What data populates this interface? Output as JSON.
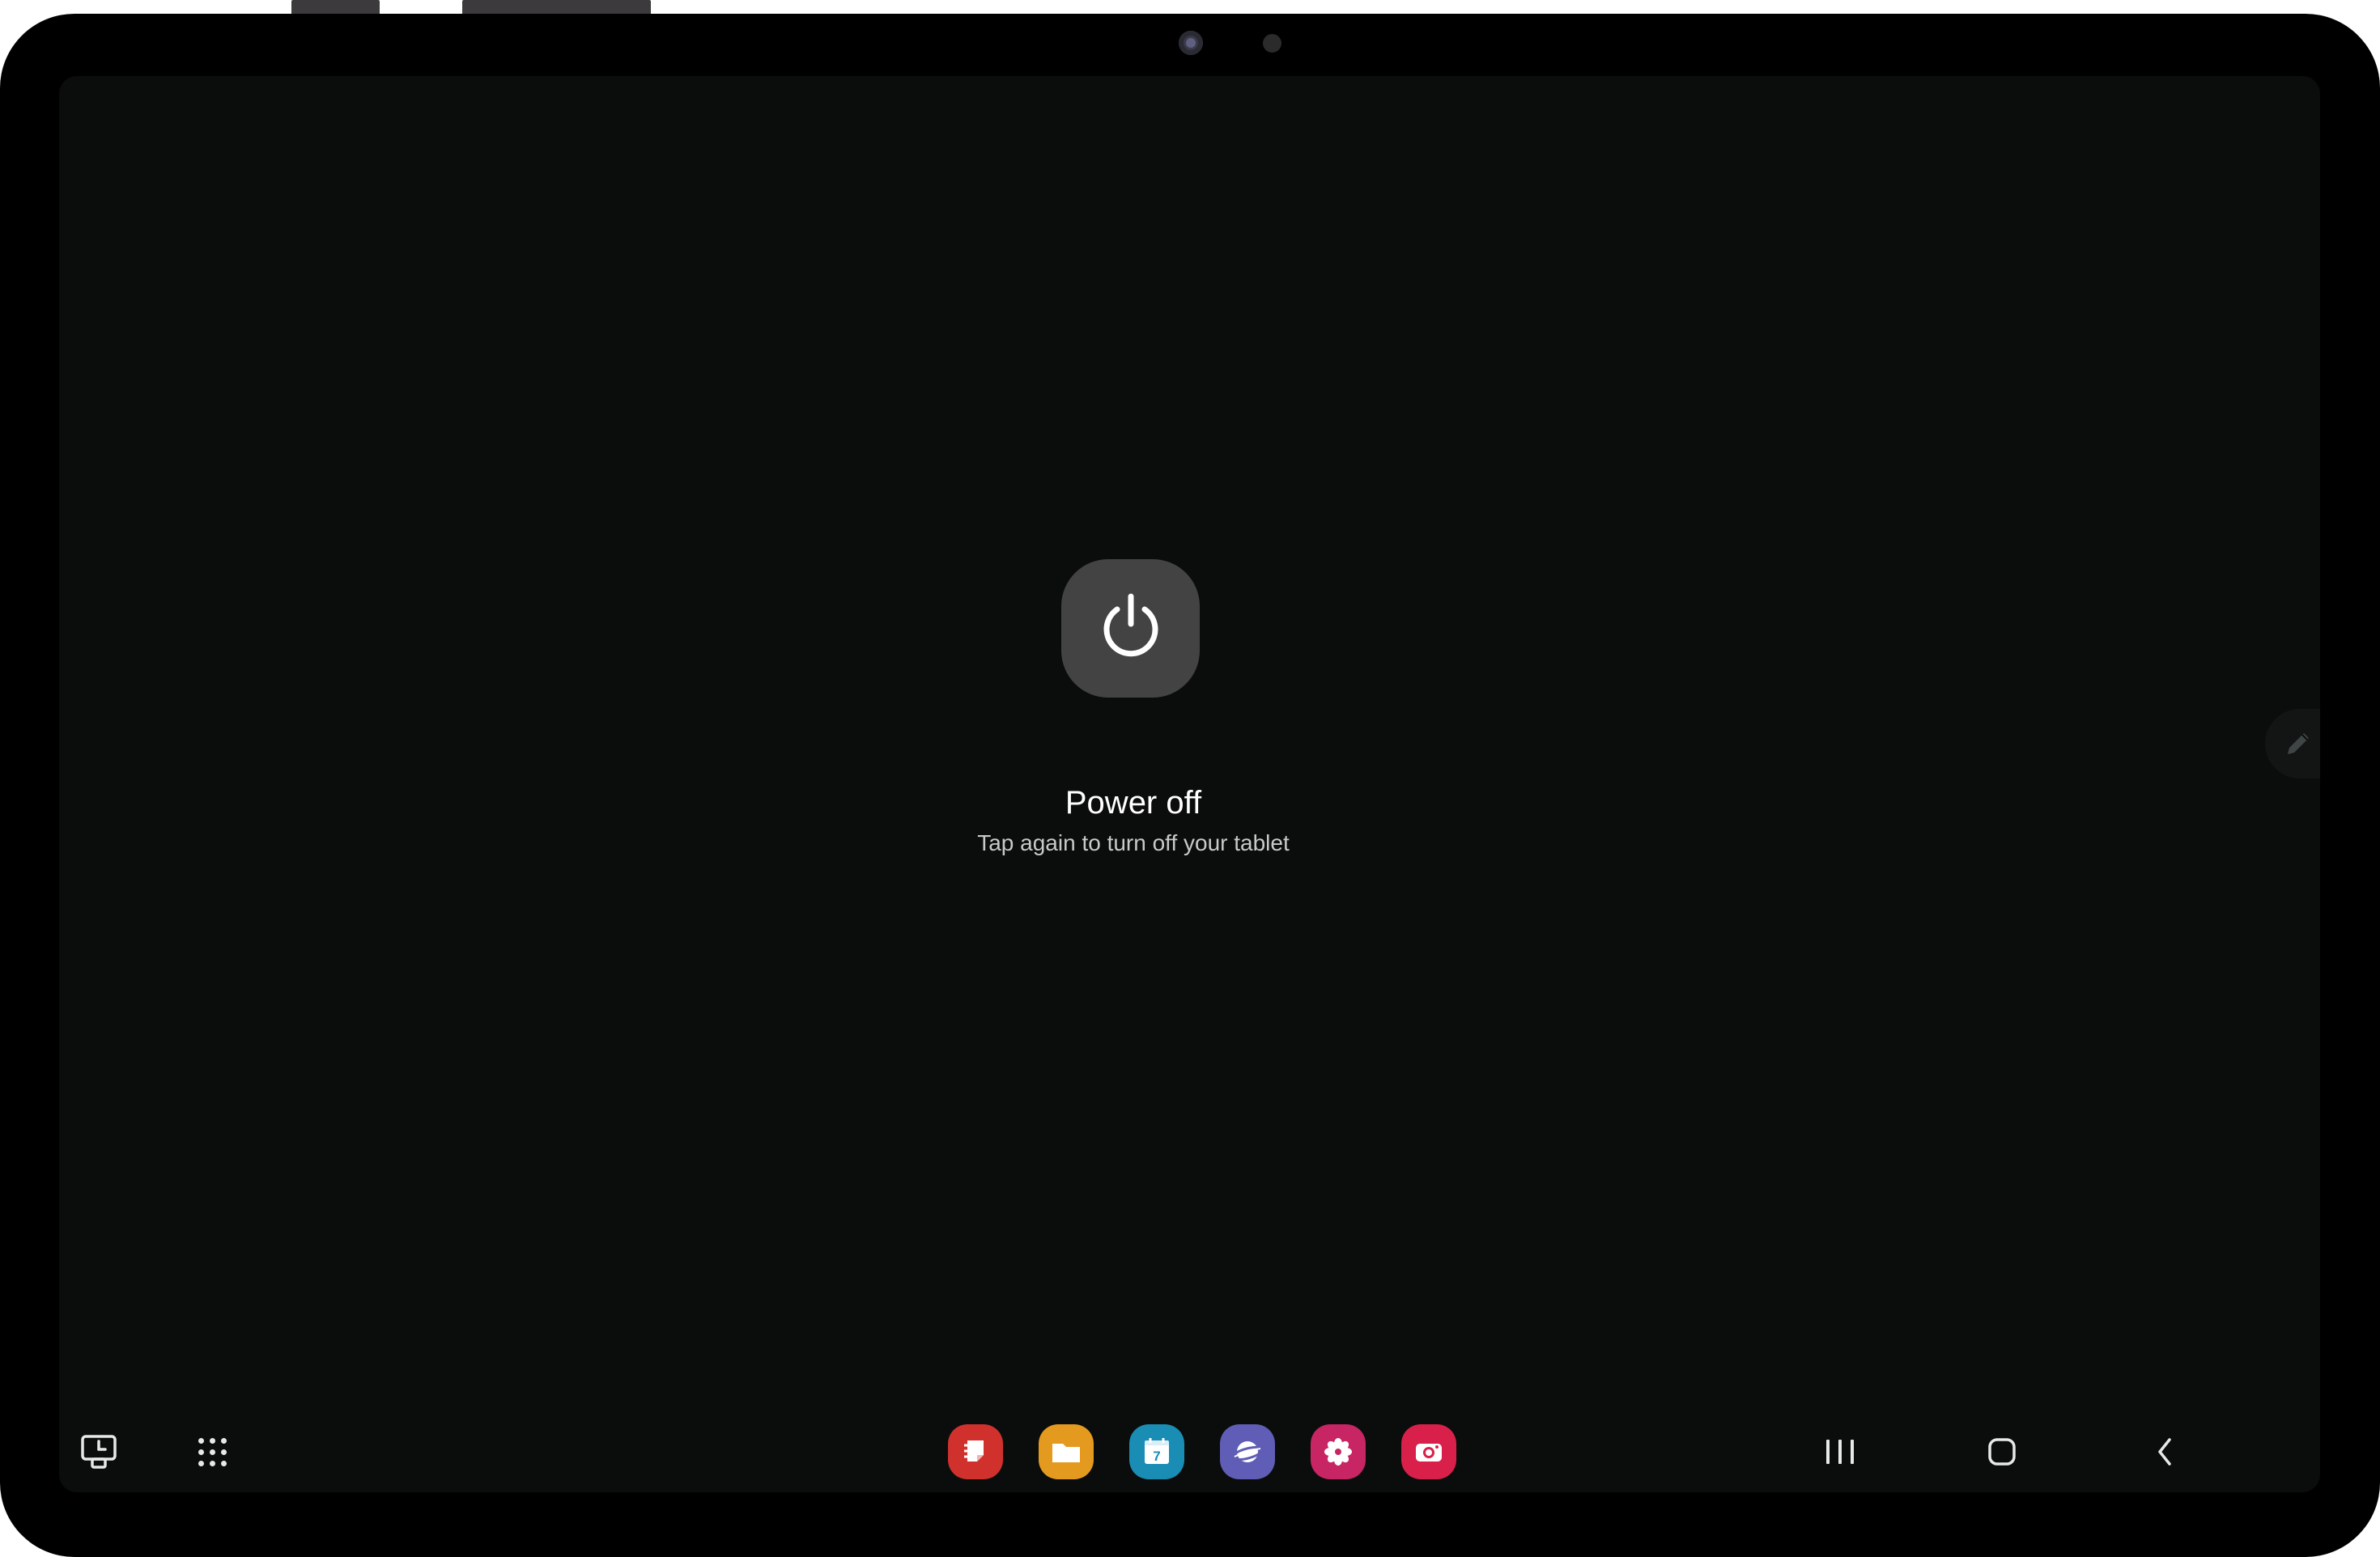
{
  "device": {
    "frame_color": "#000000",
    "screen_color": "#0b0d0d"
  },
  "power_dialog": {
    "title": "Power off",
    "subtitle": "Tap again to turn off your tablet",
    "icon": "power-icon",
    "tile_color": "#434343"
  },
  "edge_panel": {
    "icon": "pencil-icon"
  },
  "taskbar": {
    "left_buttons": [
      {
        "name": "recent-apps-history-button",
        "icon": "screen-history-icon"
      },
      {
        "name": "app-drawer-button",
        "icon": "grid-dots-icon"
      }
    ],
    "apps": [
      {
        "name": "samsung-notes",
        "icon": "notes-icon",
        "color": "#d0312d"
      },
      {
        "name": "my-files",
        "icon": "folder-icon",
        "color": "#e49a1f"
      },
      {
        "name": "calendar",
        "icon": "calendar-icon",
        "color": "#1a8db5",
        "date_number": "7"
      },
      {
        "name": "samsung-internet",
        "icon": "planet-icon",
        "color": "#5f5db5"
      },
      {
        "name": "gallery",
        "icon": "flower-icon",
        "color": "#c72563"
      },
      {
        "name": "camera",
        "icon": "camera-icon",
        "color": "#d8204a"
      }
    ],
    "nav_buttons": [
      {
        "name": "recents-button",
        "icon": "recents-icon"
      },
      {
        "name": "home-button",
        "icon": "home-icon"
      },
      {
        "name": "back-button",
        "icon": "back-chevron-icon"
      }
    ]
  }
}
